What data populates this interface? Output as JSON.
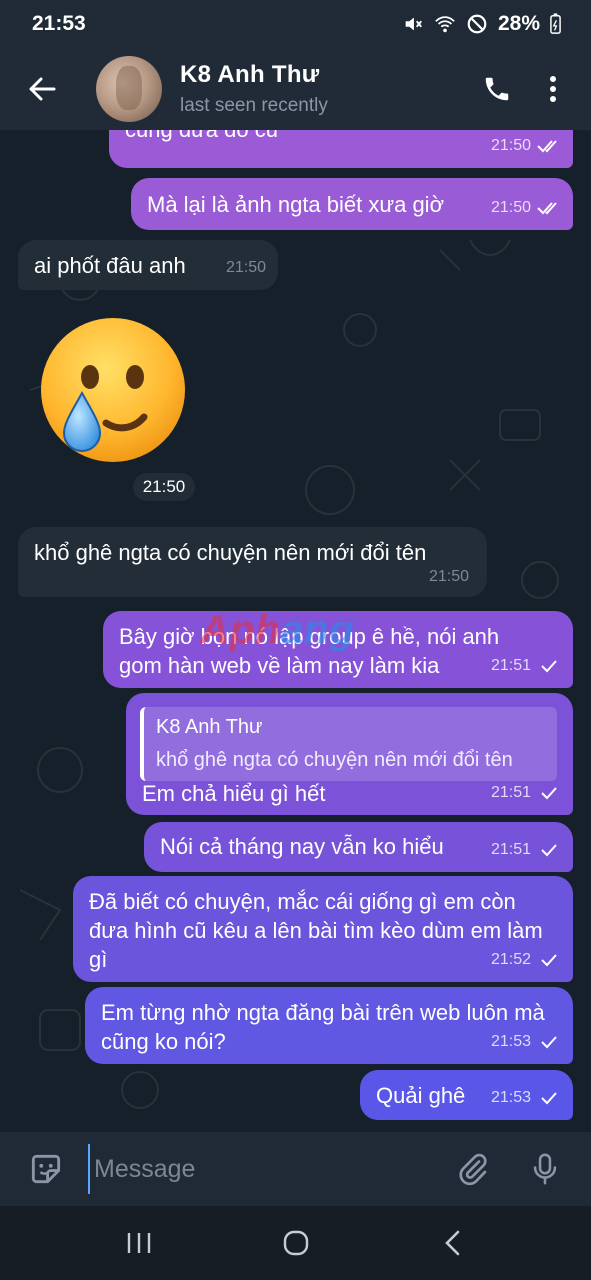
{
  "status_bar": {
    "time": "21:53",
    "battery": "28%"
  },
  "header": {
    "title": "K8 Anh Thư",
    "subtitle": "last seen recently"
  },
  "messages": [
    {
      "text": "cũng đưa đồ cũ",
      "time": "21:50"
    },
    {
      "text": "Mà lại là ảnh ngta biết xưa giờ",
      "time": "21:50"
    },
    {
      "text": "ai phốt đâu anh",
      "time": "21:50"
    },
    {
      "text": "21:50"
    },
    {
      "text": "khổ ghê ngta có chuyện nên mới đổi tên",
      "time": "21:50"
    },
    {
      "text": "Bây giờ bọn nó lập group ê hề, nói anh gom hàn web về làm nay làm kia",
      "time": "21:51"
    },
    {
      "reply_name": "K8 Anh Thư",
      "reply_text": "khổ ghê ngta có chuyện nên mới đổi tên",
      "text": "Em chả hiểu gì hết",
      "time": "21:51"
    },
    {
      "text": "Nói cả tháng nay vẫn ko hiểu",
      "time": "21:51"
    },
    {
      "text": "Đã biết có chuyện, mắc cái giống gì em còn đưa hình cũ kêu a lên bài tìm kèo dùm em làm gì",
      "time": "21:52"
    },
    {
      "text": "Em từng nhờ ngta đăng bài trên web luôn mà cũng ko nói?",
      "time": "21:53"
    },
    {
      "text": "Quải ghê",
      "time": "21:53"
    }
  ],
  "watermark": {
    "part1": "Aph",
    "part2": "ang"
  },
  "input": {
    "placeholder": "Message"
  },
  "colors": {
    "header_bg": "#202b37",
    "chat_bg": "#16202a",
    "out_top": "#a45bd6",
    "out_bottom": "#5a56e8",
    "incoming": "#222d38"
  },
  "icons": [
    "back-arrow-icon",
    "phone-icon",
    "more-vert-icon",
    "sticker-icon",
    "attach-icon",
    "mic-icon",
    "recents-icon",
    "home-icon",
    "nav-back-icon"
  ]
}
